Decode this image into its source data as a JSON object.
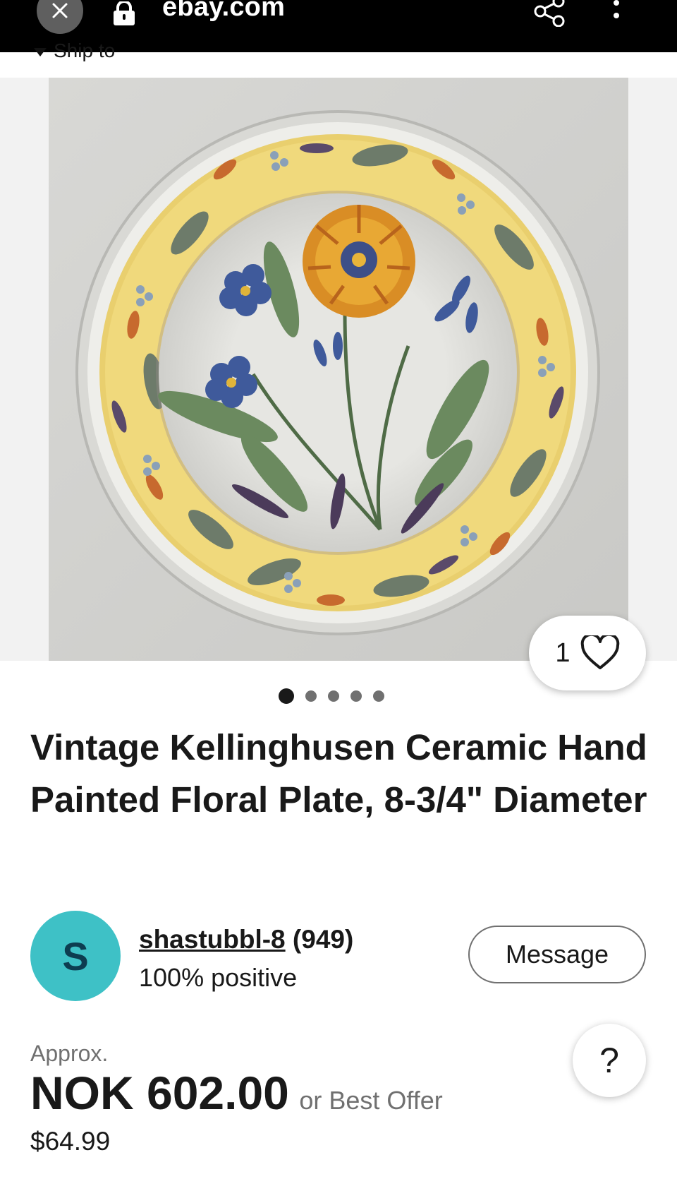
{
  "browser": {
    "url": "ebay.com",
    "icons": [
      "close-icon",
      "lock-icon",
      "share-icon",
      "more-vert-icon"
    ]
  },
  "header": {
    "ship_to": "Ship to"
  },
  "gallery": {
    "image_alt": "Vintage Kellinghusen ceramic hand painted floral plate",
    "total_images": 5,
    "active_index": 0,
    "watch_count": "1"
  },
  "listing": {
    "title": "Vintage Kellinghusen Ceramic Hand Painted Floral Plate, 8-3/4\" Diameter"
  },
  "seller": {
    "avatar_letter": "S",
    "name": "shastubbl-8",
    "feedback_count": "(949)",
    "rating": "100% positive",
    "message_label": "Message"
  },
  "price": {
    "approx_label": "Approx.",
    "amount": "NOK 602.00",
    "offer_text": "or Best Offer",
    "usd": "$64.99"
  },
  "help": {
    "label": "?"
  },
  "colors": {
    "accent_avatar": "#3ec1c6",
    "text_primary": "#191919",
    "text_secondary": "#707070"
  }
}
